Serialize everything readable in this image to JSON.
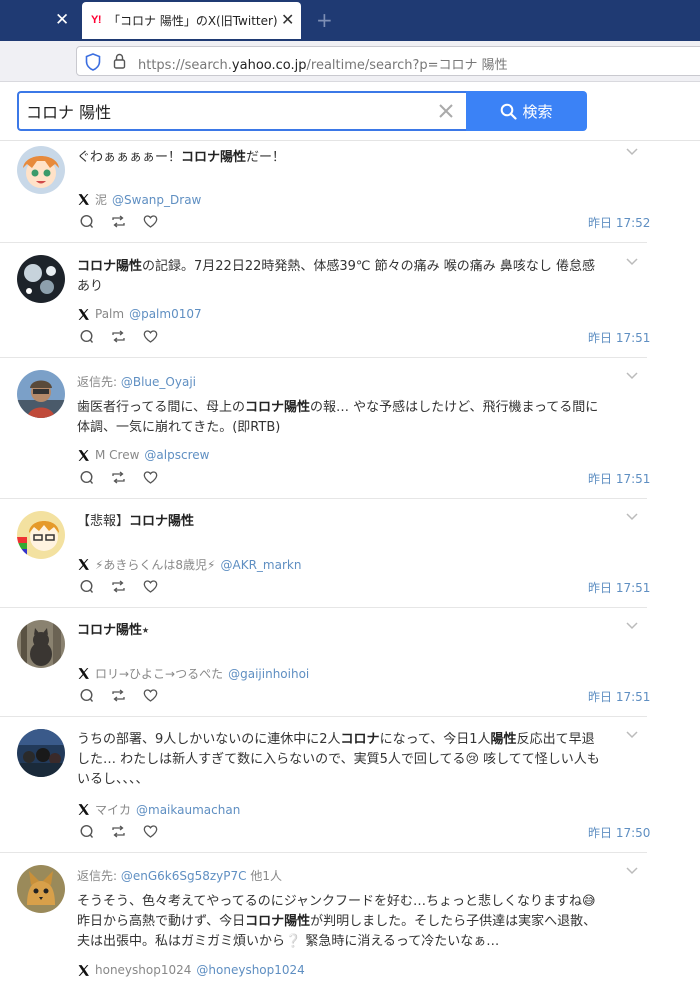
{
  "browser": {
    "active_tab_title": "「コロナ 陽性」のX(旧Twitter)検索",
    "url_prefix": "https://search.",
    "url_domain": "yahoo.co.jp",
    "url_path": "/realtime/search?p=コロナ 陽性"
  },
  "search": {
    "query": "コロナ 陽性",
    "button_label": "検索"
  },
  "tweets": [
    {
      "avatar": "anime-girl",
      "reply_to_label": "",
      "reply_to_handle": "",
      "reply_to_extra": "",
      "text": [
        {
          "t": "ぐわぁぁぁぁー！",
          "b": false
        },
        {
          "t": "コロナ陽性",
          "b": true
        },
        {
          "t": "だー！",
          "b": false
        }
      ],
      "author_name": "泥",
      "author_handle": "@Swanp_Draw",
      "time": "昨日 17:52"
    },
    {
      "avatar": "dark-lights",
      "reply_to_label": "",
      "reply_to_handle": "",
      "reply_to_extra": "",
      "text": [
        {
          "t": "コロナ陽性",
          "b": true
        },
        {
          "t": "の記録。7月22日22時発熱、体感39℃ 節々の痛み 喉の痛み 鼻咳なし 倦怠感あり",
          "b": false
        }
      ],
      "author_name": "Palm",
      "author_handle": "@palm0107",
      "time": "昨日 17:51"
    },
    {
      "avatar": "pilot",
      "reply_to_label": "返信先: ",
      "reply_to_handle": "@Blue_Oyaji",
      "reply_to_extra": "",
      "text": [
        {
          "t": "歯医者行ってる間に、母上の",
          "b": false
        },
        {
          "t": "コロナ陽性",
          "b": true
        },
        {
          "t": "の報… やな予感はしたけど、飛行機まってる間に体調、一気に崩れてきた。(即RTB)",
          "b": false
        }
      ],
      "author_name": "M Crew",
      "author_handle": "@alpscrew",
      "time": "昨日 17:51"
    },
    {
      "avatar": "anime-boy",
      "reply_to_label": "",
      "reply_to_handle": "",
      "reply_to_extra": "",
      "text": [
        {
          "t": "【悲報】",
          "b": false
        },
        {
          "t": "コロナ陽性",
          "b": true
        }
      ],
      "author_name": "⚡あきらくんは8歳児⚡",
      "author_handle": "@AKR_markn",
      "time": "昨日 17:51"
    },
    {
      "avatar": "cat",
      "reply_to_label": "",
      "reply_to_handle": "",
      "reply_to_extra": "",
      "text": [
        {
          "t": "コロナ陽性",
          "b": true
        },
        {
          "t": "⭑",
          "b": false
        }
      ],
      "author_name": "ロリ→ひよこ→つるぺた",
      "author_handle": "@gaijinhoihoi",
      "time": "昨日 17:51"
    },
    {
      "avatar": "crowd",
      "reply_to_label": "",
      "reply_to_handle": "",
      "reply_to_extra": "",
      "text": [
        {
          "t": "うちの部署、9人しかいないのに連休中に2人",
          "b": false
        },
        {
          "t": "コロナ",
          "b": true
        },
        {
          "t": "になって、今日1人",
          "b": false
        },
        {
          "t": "陽性",
          "b": true
        },
        {
          "t": "反応出て早退した… わたしは新人すぎて数に入らないので、実質5人で回してる😢 咳してて怪しい人もいるし、、、、",
          "b": false
        }
      ],
      "author_name": "マイカ",
      "author_handle": "@maikaumachan",
      "time": "昨日 17:50"
    },
    {
      "avatar": "fox",
      "reply_to_label": "返信先: ",
      "reply_to_handle": "@enG6k6Sg58zyP7C",
      "reply_to_extra": " 他1人",
      "text": [
        {
          "t": "そうそう、色々考えてやってるのにジャンクフードを好む…ちょっと悲しくなりますね😅 昨日から高熱で動けず、今日",
          "b": false
        },
        {
          "t": "コロナ陽性",
          "b": true
        },
        {
          "t": "が判明しました。そしたら子供達は実家へ退散、夫は出張中。私はガミガミ煩いから❔ 緊急時に消えるって冷たいなぁ…",
          "b": false
        }
      ],
      "author_name": "honeyshop1024",
      "author_handle": "@honeyshop1024",
      "time": ""
    }
  ]
}
